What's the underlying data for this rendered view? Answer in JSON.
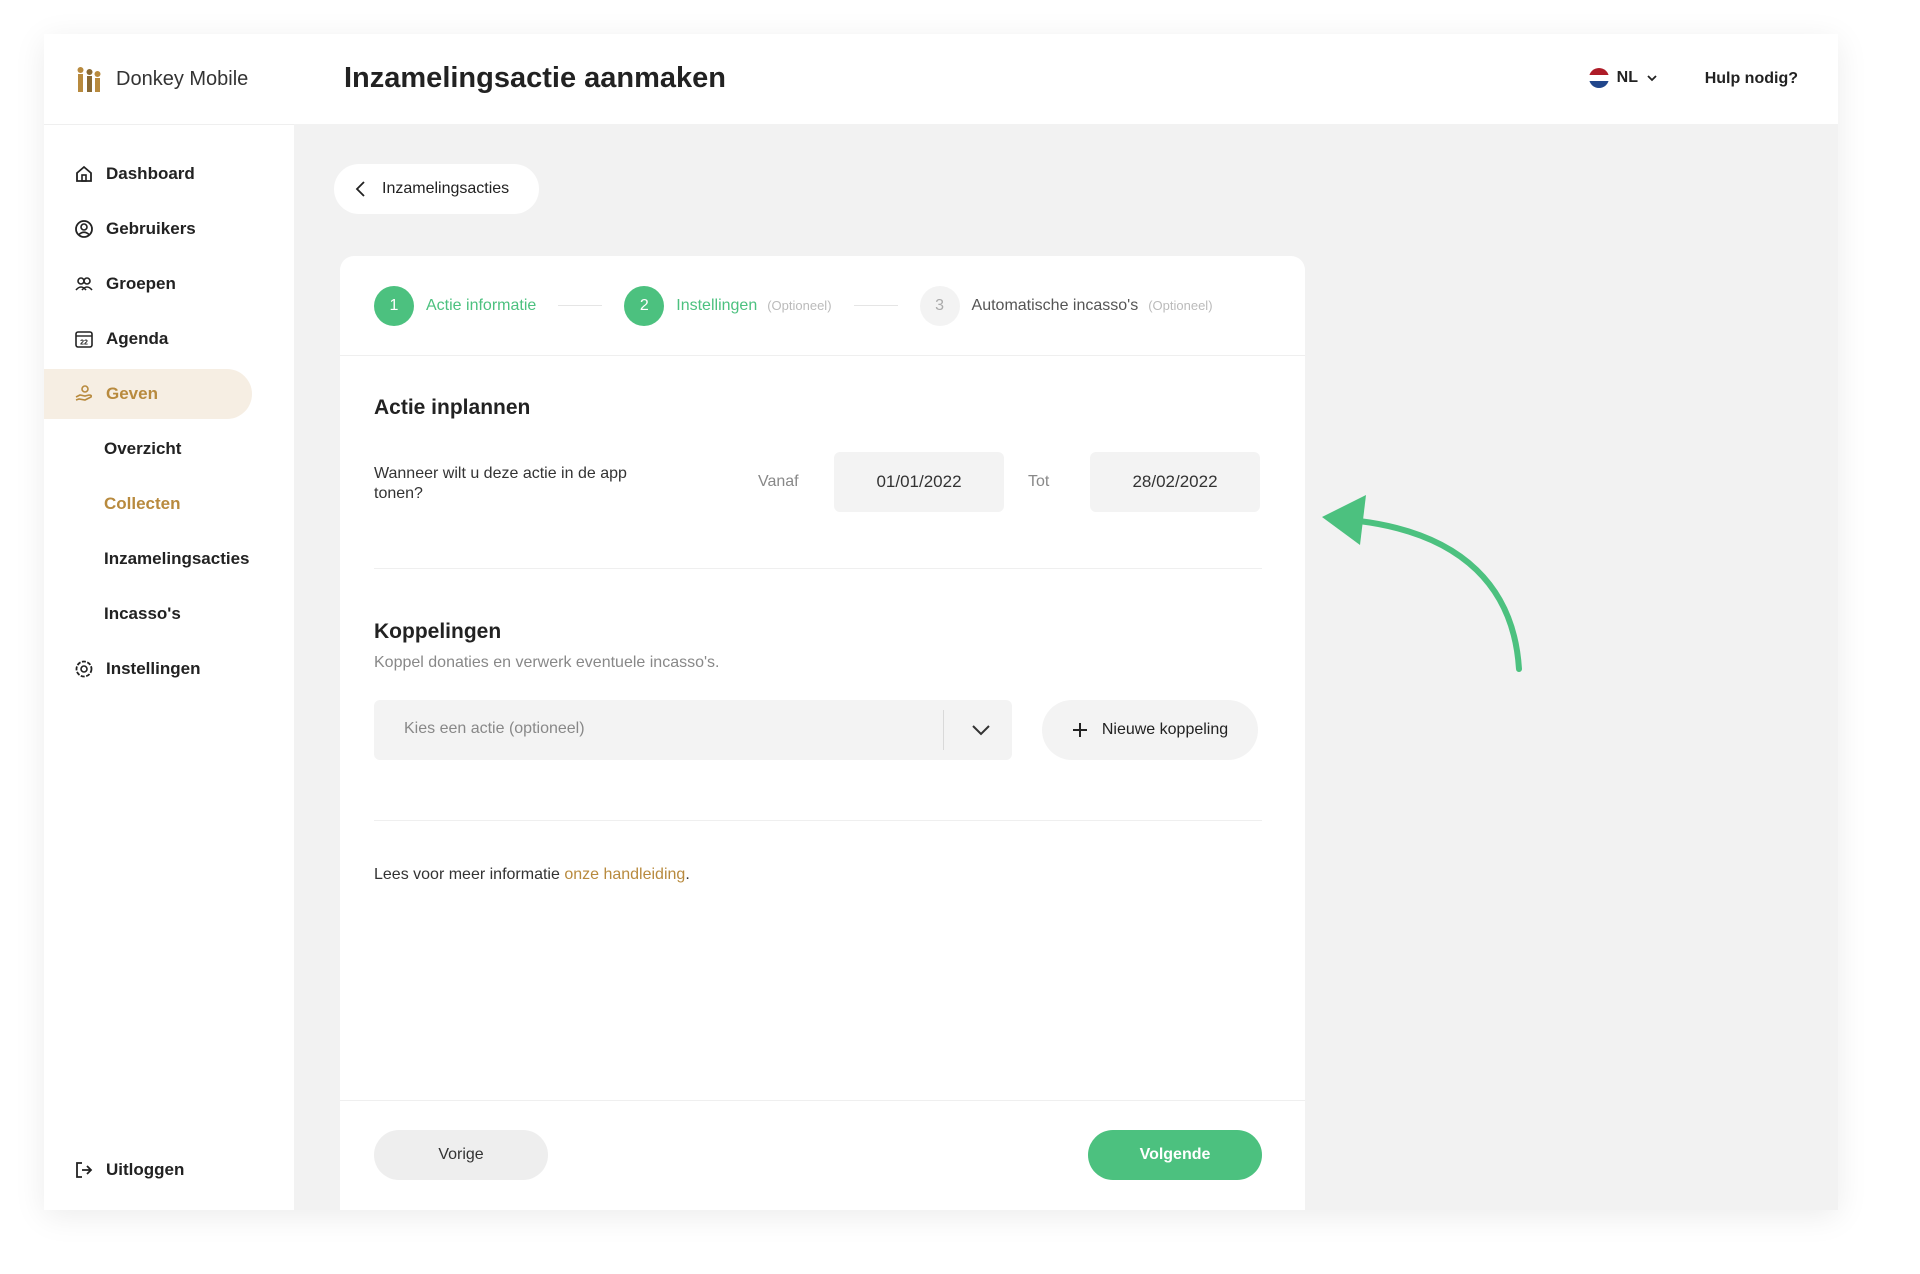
{
  "brand": {
    "name": "Donkey Mobile"
  },
  "sidebar": {
    "items": [
      {
        "label": "Dashboard",
        "icon": "home-icon"
      },
      {
        "label": "Gebruikers",
        "icon": "user-icon"
      },
      {
        "label": "Groepen",
        "icon": "group-icon"
      },
      {
        "label": "Agenda",
        "icon": "calendar-icon"
      },
      {
        "label": "Geven",
        "icon": "giving-icon",
        "active": true
      },
      {
        "label": "Overzicht"
      },
      {
        "label": "Collecten",
        "current": true
      },
      {
        "label": "Inzamelingsacties"
      },
      {
        "label": "Incasso's"
      },
      {
        "label": "Instellingen",
        "icon": "settings-icon"
      }
    ],
    "logout_label": "Uitloggen"
  },
  "header": {
    "title": "Inzamelingsactie aanmaken",
    "language": "NL",
    "help_label": "Hulp nodig?"
  },
  "breadcrumb": {
    "back_label": "Inzamelingsacties"
  },
  "stepper": {
    "steps": [
      {
        "number": "1",
        "label": "Actie informatie",
        "optional": "",
        "state": "done"
      },
      {
        "number": "2",
        "label": "Instellingen",
        "optional": "(Optioneel)",
        "state": "done"
      },
      {
        "number": "3",
        "label": "Automatische incasso's",
        "optional": "(Optioneel)",
        "state": "todo"
      }
    ]
  },
  "schedule": {
    "title": "Actie inplannen",
    "question": "Wanneer wilt u deze actie in de app tonen?",
    "from_label": "Vanaf",
    "from_value": "01/01/2022",
    "to_label": "Tot",
    "to_value": "28/02/2022"
  },
  "links": {
    "title": "Koppelingen",
    "subtitle": "Koppel donaties en verwerk eventuele incasso's.",
    "select_placeholder": "Kies een actie (optioneel)",
    "new_link_label": "Nieuwe koppeling"
  },
  "info": {
    "text": "Lees voor meer informatie ",
    "link_label": "onze handleiding",
    "suffix": "."
  },
  "footer": {
    "prev_label": "Vorige",
    "next_label": "Volgende"
  },
  "colors": {
    "accent_green": "#4cc17f",
    "accent_gold": "#b88a3e",
    "background": "#f2f2f2"
  }
}
